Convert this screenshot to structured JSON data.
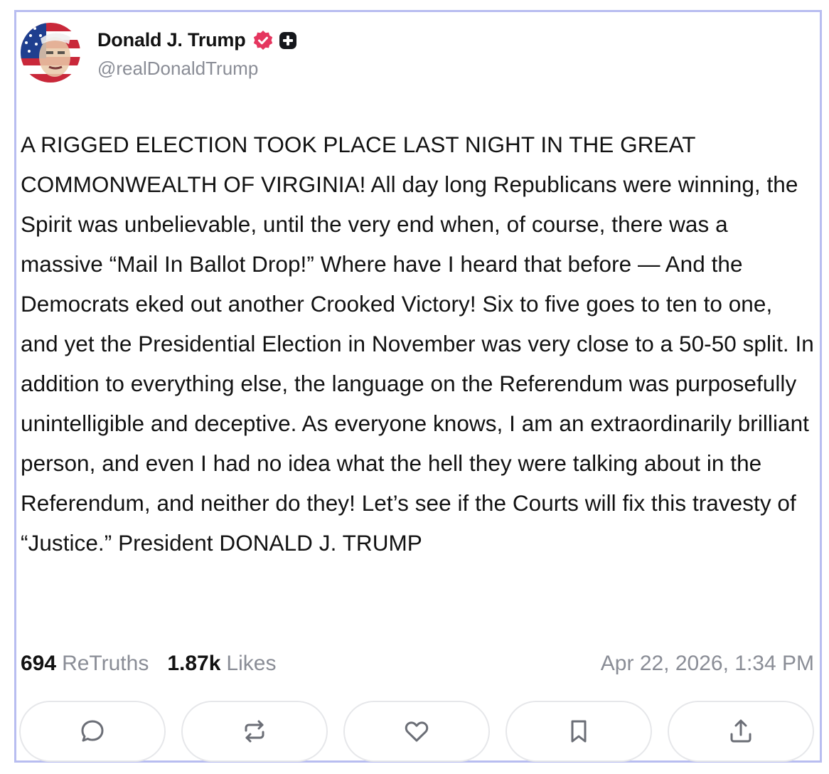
{
  "author": {
    "display_name": "Donald J. Trump",
    "handle": "@realDonaldTrump",
    "avatar_icon": "avatar-flag-portrait",
    "verified_icon": "verified-badge-icon",
    "verified_color": "#e5365f",
    "plus_icon": "plus-badge-icon"
  },
  "post": {
    "text": "A RIGGED ELECTION TOOK PLACE LAST NIGHT IN THE GREAT COMMONWEALTH OF VIRGINIA! All day long Republicans were winning, the Spirit was unbelievable, until the very end when, of course, there was a massive “Mail In Ballot Drop!” Where have I heard that before — And the Democrats eked out another Crooked Victory! Six to five goes to ten to one, and yet the Presidential Election in November was very close to a 50-50 split. In addition to everything else, the language on the Referendum was purposefully unintelligible and deceptive. As everyone knows, I am an extraordinarily brilliant person, and even I had no idea what the hell they were talking about in the Referendum, and neither do they! Let’s see if the Courts will fix this travesty of “Justice.” President DONALD J. TRUMP"
  },
  "stats": {
    "retruths_count": "694",
    "retruths_label": "ReTruths",
    "likes_count": "1.87k",
    "likes_label": "Likes",
    "timestamp": "Apr 22, 2026, 1:34 PM"
  },
  "actions": [
    {
      "icon": "reply-icon"
    },
    {
      "icon": "retruth-icon"
    },
    {
      "icon": "like-heart-icon"
    },
    {
      "icon": "bookmark-icon"
    },
    {
      "icon": "share-upload-icon"
    }
  ],
  "colors": {
    "border": "#b8bdf0",
    "muted_text": "#8a8d96",
    "main_text": "#121212",
    "button_border": "#e6e7ea",
    "icon_gray": "#6b6e76"
  }
}
